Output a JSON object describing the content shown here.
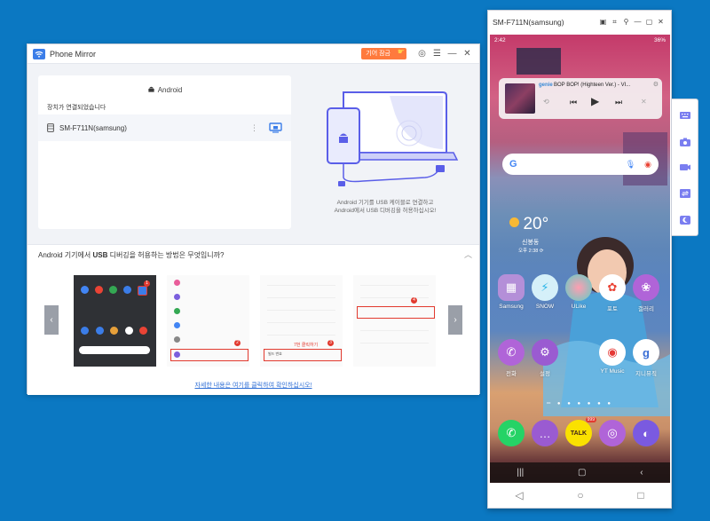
{
  "pm_window": {
    "title": "Phone Mirror",
    "promo_label": "기어 잠금",
    "android_title": "Android",
    "connected_label": "장치가 연결되었습니다",
    "device_name": "SM-F711N(samsung)",
    "instruction_line1": "Android 기기를 USB 케이블로 연결하고",
    "instruction_line2": "Android에서 USB 디버깅을 허용하십시오!",
    "help_question_pre": "Android 기기에서 ",
    "help_question_bold": "USB",
    "help_question_post": " 디버깅을 허용하는 방법은 무엇입니까?",
    "help_link": "자세한 내용은 여기를 클릭하여 확인하십시오!",
    "step_numbers": [
      "1",
      "2",
      "3",
      "4"
    ],
    "step3_note": "7번 클릭하기",
    "step3_row": "빌드 번호"
  },
  "phone_window": {
    "title": "SM-F711N(samsung)",
    "status_time": "2:42",
    "status_right": "36%",
    "music": {
      "service": "genie",
      "track": "BOP BOP! (Highteen Ver.) - VI..."
    },
    "weather": {
      "temp": "20°",
      "location": "신봉동",
      "updated": "오후 2:38 ⟳"
    },
    "apps_row1": [
      {
        "label": "Samsung",
        "icon": "samsung-folder-icon"
      },
      {
        "label": "SNOW",
        "icon": "snow-icon"
      },
      {
        "label": "ULike",
        "icon": "ulike-icon"
      },
      {
        "label": "포토",
        "icon": "google-photos-icon"
      },
      {
        "label": "갤러리",
        "icon": "gallery-icon"
      }
    ],
    "apps_row2": [
      {
        "label": "전화",
        "icon": "phone-icon"
      },
      {
        "label": "설정",
        "icon": "settings-icon"
      },
      {
        "label": "YT Music",
        "icon": "yt-music-icon"
      },
      {
        "label": "지니뮤직",
        "icon": "genie-music-icon"
      }
    ],
    "dock_badge": "999"
  },
  "colors": {
    "desktop": "#0b78c2",
    "accent": "#5a5ee8",
    "promo": "#ff7a3d",
    "red_marker": "#e23a2f"
  }
}
